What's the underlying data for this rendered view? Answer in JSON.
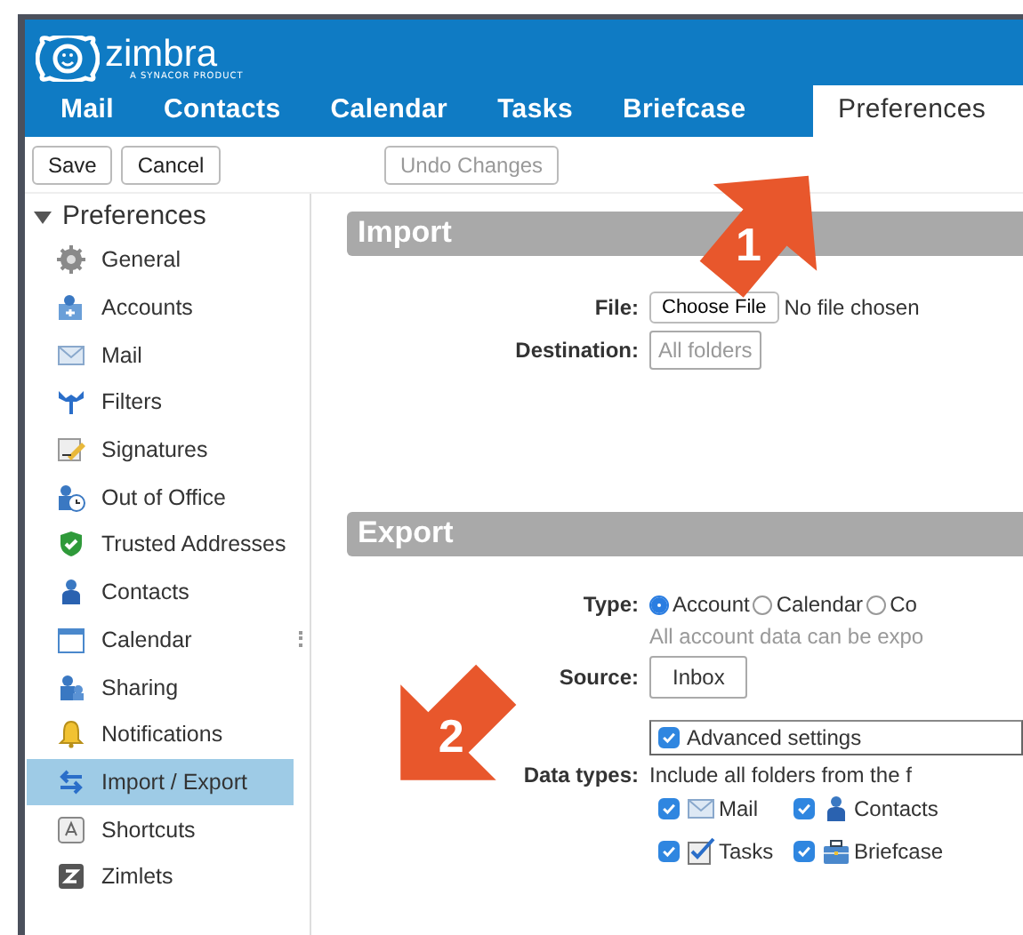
{
  "app": {
    "logo": "zimbra",
    "tagline": "A SYNACOR PRODUCT"
  },
  "tabs": [
    {
      "label": "Mail",
      "selected": false
    },
    {
      "label": "Contacts",
      "selected": false
    },
    {
      "label": "Calendar",
      "selected": false
    },
    {
      "label": "Tasks",
      "selected": false
    },
    {
      "label": "Briefcase",
      "selected": false
    },
    {
      "label": "Preferences",
      "selected": true
    }
  ],
  "toolbar": {
    "buttons": [
      {
        "label": "Save",
        "disabled": false
      },
      {
        "label": "Cancel",
        "disabled": false
      }
    ],
    "undo": {
      "label": "Undo Changes",
      "disabled": true
    }
  },
  "sidebar": {
    "title": "Preferences",
    "expanded": true,
    "items": [
      {
        "label": "General",
        "selected": false
      },
      {
        "label": "Accounts",
        "selected": false
      },
      {
        "label": "Mail",
        "selected": false
      },
      {
        "label": "Filters",
        "selected": false
      },
      {
        "label": "Signatures",
        "selected": false
      },
      {
        "label": "Out of Office",
        "selected": false
      },
      {
        "label": "Trusted Addresses",
        "selected": false
      },
      {
        "label": "Contacts",
        "selected": false
      },
      {
        "label": "Calendar",
        "selected": false
      },
      {
        "label": "Sharing",
        "selected": false
      },
      {
        "label": "Notifications",
        "selected": false
      },
      {
        "label": "Import / Export",
        "selected": true
      },
      {
        "label": "Shortcuts",
        "selected": false
      },
      {
        "label": "Zimlets",
        "selected": false
      }
    ]
  },
  "import": {
    "title": "Import",
    "file_label": "File:",
    "choose_button": "Choose File",
    "file_status": "No file chosen",
    "destination_label": "Destination:",
    "destination_value": "All folders"
  },
  "export": {
    "title": "Export",
    "type_label": "Type:",
    "types": [
      {
        "label": "Account",
        "selected": true
      },
      {
        "label": "Calendar",
        "selected": false
      },
      {
        "label": "Co",
        "selected": false
      }
    ],
    "type_hint": "All account data can be expo",
    "source_label": "Source:",
    "source_value": "Inbox",
    "advanced": {
      "label": "Advanced settings",
      "checked": true
    },
    "data_types_label": "Data types:",
    "data_types_hint": "Include all folders from the f",
    "data_types": [
      {
        "label": "Mail",
        "checked": true
      },
      {
        "label": "Contacts",
        "checked": true
      },
      {
        "label": "Tasks",
        "checked": true
      },
      {
        "label": "Briefcase",
        "checked": true
      }
    ]
  },
  "callouts": [
    {
      "number": "1"
    },
    {
      "number": "2"
    }
  ]
}
